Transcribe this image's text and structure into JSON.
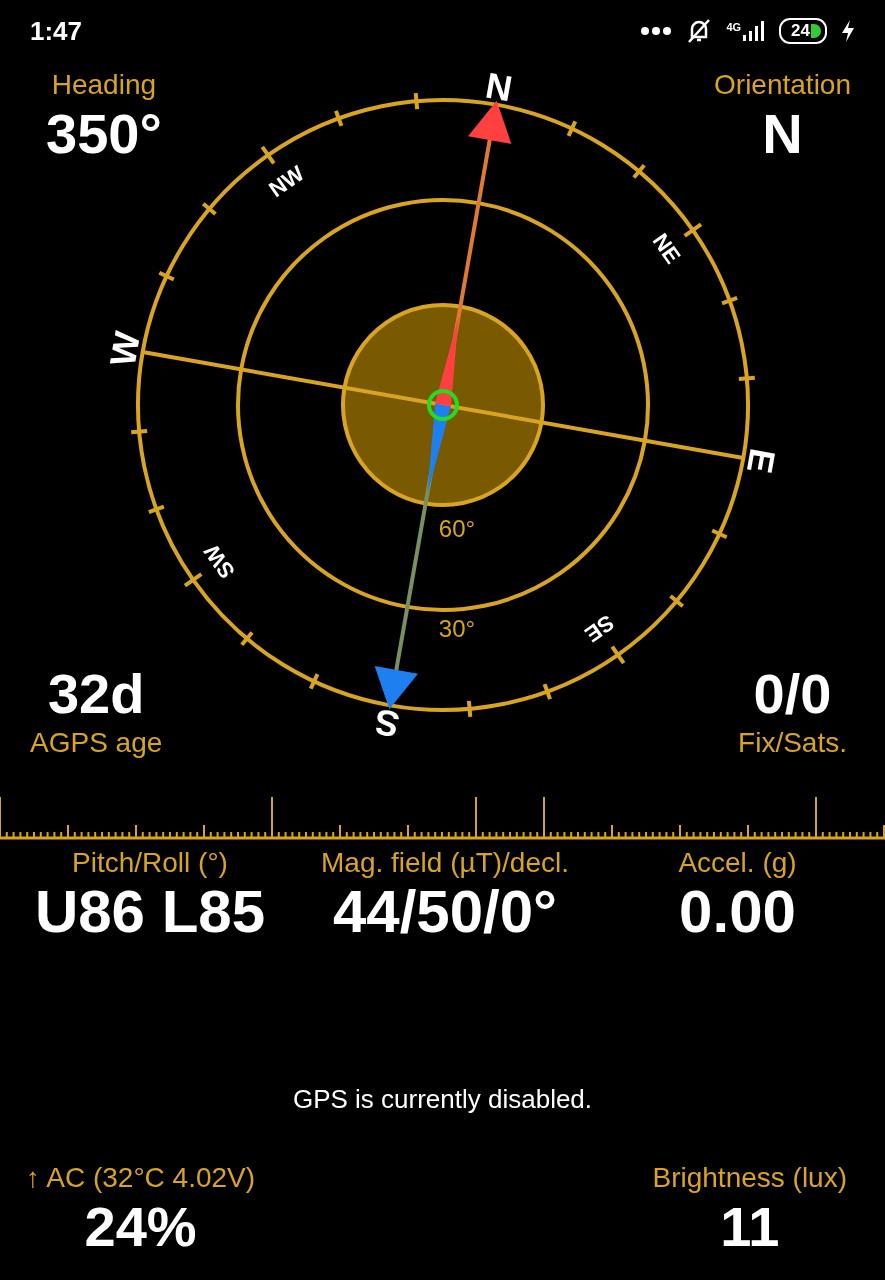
{
  "status_bar": {
    "time": "1:47",
    "network": "4G",
    "battery": "24"
  },
  "heading": {
    "label": "Heading",
    "value": "350°"
  },
  "orientation": {
    "label": "Orientation",
    "value": "N"
  },
  "agps": {
    "value": "32d",
    "label": "AGPS age"
  },
  "fix": {
    "value": "0/0",
    "label": "Fix/Sats."
  },
  "compass": {
    "directions": [
      "N",
      "NE",
      "E",
      "SE",
      "S",
      "SW",
      "W",
      "NW"
    ],
    "elevations": [
      "60°",
      "30°"
    ]
  },
  "metrics": [
    {
      "label": "Pitch/Roll (°)",
      "value": "U86 L85"
    },
    {
      "label": "Mag. field (µT)/decl.",
      "value": "44/50/0°"
    },
    {
      "label": "Accel. (g)",
      "value": "0.00"
    }
  ],
  "gps_message": "GPS is currently disabled.",
  "battery": {
    "label": "↑ AC (32°C 4.02V)",
    "value": "24%"
  },
  "brightness": {
    "label": "Brightness (lux)",
    "value": "11"
  }
}
